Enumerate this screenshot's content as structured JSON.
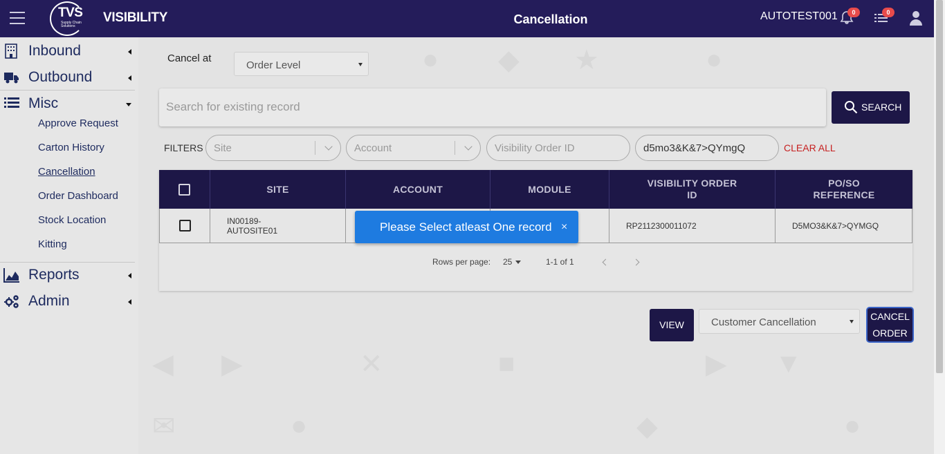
{
  "header": {
    "brand": "VISIBILITY",
    "logo_text": "TVS",
    "logo_subtext": "Supply Chain Solutions",
    "page_title": "Cancellation",
    "username": "AUTOTEST001",
    "notifications_count": "0",
    "tasks_count": "0"
  },
  "sidebar": {
    "main_items": [
      {
        "label": "Inbound",
        "icon": "building-icon"
      },
      {
        "label": "Outbound",
        "icon": "truck-icon"
      },
      {
        "label": "Misc",
        "icon": "list-icon"
      },
      {
        "label": "Reports",
        "icon": "area-chart-icon"
      },
      {
        "label": "Admin",
        "icon": "gears-icon"
      }
    ],
    "sub_items": [
      "Approve Request",
      "Carton History",
      "Cancellation",
      "Order Dashboard",
      "Stock Location",
      "Kitting"
    ],
    "active_sub": "Cancellation"
  },
  "main": {
    "cancel_at_label": "Cancel at",
    "cancel_at_value": "Order Level",
    "search_placeholder": "Search for existing record",
    "search_button": "SEARCH",
    "filters_label": "FILTERS",
    "filter_site_placeholder": "Site",
    "filter_account_placeholder": "Account",
    "filter_visibility_placeholder": "Visibility Order ID",
    "filter_po_value": "d5mo3&K&7>QYmgQ",
    "clear_all": "CLEAR ALL"
  },
  "table": {
    "columns": [
      "SITE",
      "ACCOUNT",
      "MODULE",
      "VISIBILITY ORDER ID",
      "PO/SO REFERENCE"
    ],
    "columns_display": {
      "site": "SITE",
      "account": "ACCOUNT",
      "module": "MODULE",
      "visibility_line1": "VISIBILITY ORDER",
      "visibility_line2": "ID",
      "po_line1": "PO/SO",
      "po_line2": "REFERENCE"
    },
    "row": {
      "site_line1": "IN00189-",
      "site_line2": "AUTOSITE01",
      "account": "",
      "module": "",
      "visibility_order_id": "RP2112300011072",
      "po_so_reference": "D5MO3&K&7>QYMGQ"
    },
    "rows_per_page_label": "Rows per page:",
    "rows_per_page_value": "25",
    "range_text": "1-1 of 1"
  },
  "actions": {
    "view_button": "VIEW",
    "cancellation_type": "Customer Cancellation",
    "cancel_order_line1": "CANCEL",
    "cancel_order_line2": "ORDER"
  },
  "toast": {
    "message": "Please Select atleast One record",
    "close": "×"
  },
  "colors": {
    "header_bg": "#241c5a",
    "button_bg": "#1d1747",
    "toast_bg": "#1e7be0",
    "clear_all": "#c62020",
    "badge": "#e84b4b"
  }
}
